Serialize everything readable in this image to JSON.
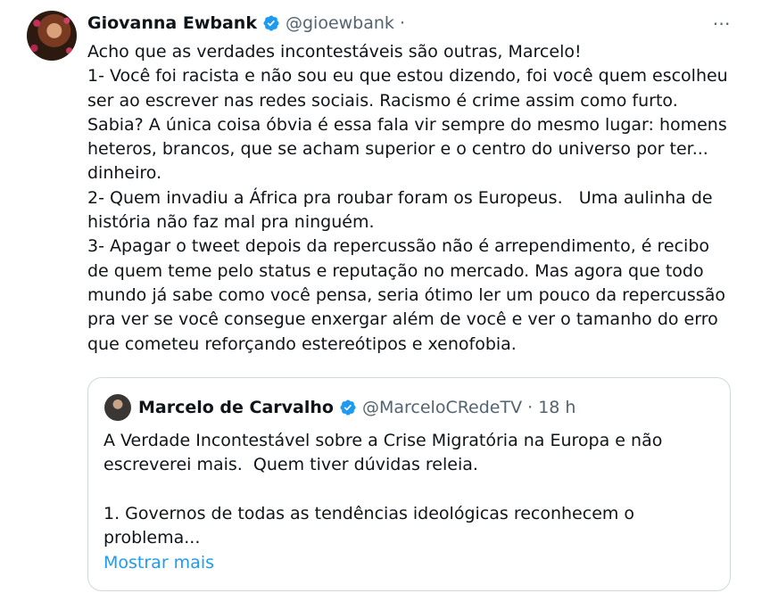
{
  "tweet": {
    "author_name": "Giovanna Ewbank",
    "author_handle": "@gioewbank ·",
    "more_icon": "⋯",
    "lines": [
      "Acho que as verdades incontestáveis são outras, Marcelo!",
      "1- Você foi racista e não sou eu que estou dizendo, foi você quem escolheu",
      "ser ao escrever nas redes sociais. Racismo é crime assim como furto.",
      "Sabia? A única coisa óbvia é essa fala vir sempre do mesmo lugar: homens",
      "heteros, brancos, que se acham superior e o centro do universo por ter...",
      "dinheiro.",
      "2- Quem invadiu a África pra roubar foram os Europeus.   Uma aulinha de",
      "história não faz mal pra ninguém.",
      "3- Apagar o tweet depois da repercussão não é arrependimento, é recibo",
      "de quem teme pelo status e reputação no mercado. Mas agora que todo",
      "mundo já sabe como você pensa, seria ótimo ler um pouco da repercussão",
      "pra ver se você consegue enxergar além de você e ver o tamanho do erro",
      "que cometeu reforçando estereótipos e xenofobia."
    ]
  },
  "quote": {
    "author_name": "Marcelo de Carvalho",
    "author_handle": "@MarceloCRedeTV · 18 h",
    "lines": [
      "A Verdade Incontestável sobre a Crise Migratória na Europa e não",
      "escreverei mais.  Quem tiver dúvidas releia.",
      "",
      "1. Governos de todas as tendências ideológicas reconhecem o",
      "problema..."
    ],
    "show_more": "Mostrar mais"
  },
  "colors": {
    "verified": "#1d9bf0",
    "link": "#1d9bf0",
    "secondary_text": "#536471",
    "border": "#cfd9de"
  }
}
